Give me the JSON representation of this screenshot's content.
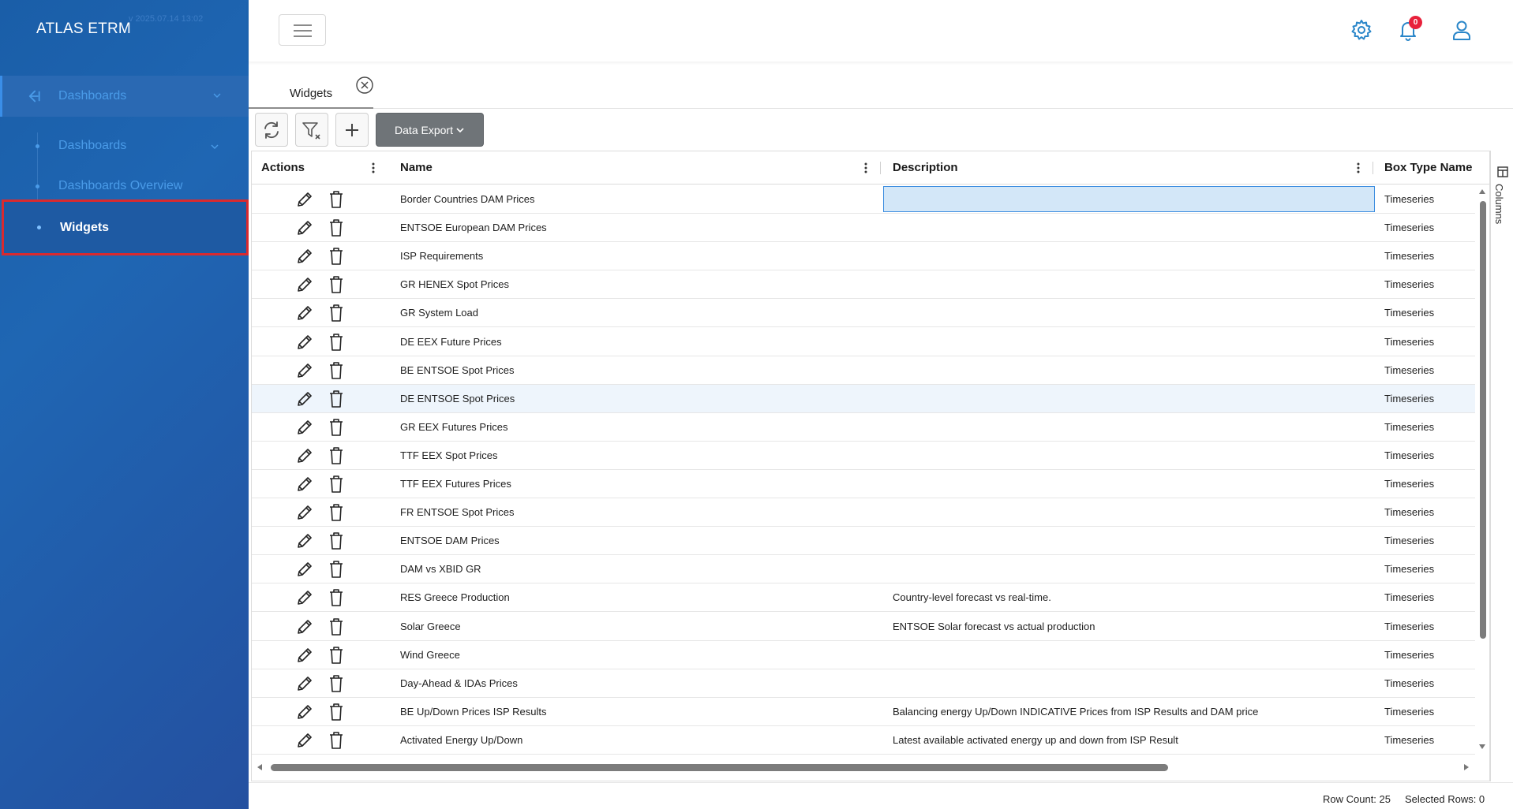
{
  "app": {
    "title": "ATLAS ETRM",
    "version": "v 2025.07.14 13:02"
  },
  "sidebar": {
    "section": {
      "label": "Dashboards"
    },
    "items": [
      {
        "label": "Dashboards"
      },
      {
        "label": "Dashboards Overview"
      },
      {
        "label": "Widgets"
      }
    ]
  },
  "header": {
    "notifications_count": "0"
  },
  "tabs": [
    {
      "label": "Widgets"
    }
  ],
  "toolbar": {
    "export_label": "Data Export"
  },
  "grid": {
    "columns": [
      "Actions",
      "Name",
      "Description",
      "Box Type Name"
    ],
    "rows": [
      {
        "name": "Border Countries DAM Prices",
        "description": "",
        "box_type": "Timeseries"
      },
      {
        "name": "ENTSOE European DAM Prices",
        "description": "",
        "box_type": "Timeseries"
      },
      {
        "name": "ISP Requirements",
        "description": "",
        "box_type": "Timeseries"
      },
      {
        "name": "GR HENEX Spot Prices",
        "description": "",
        "box_type": "Timeseries"
      },
      {
        "name": "GR System Load",
        "description": "",
        "box_type": "Timeseries"
      },
      {
        "name": "DE EEX Future Prices",
        "description": "",
        "box_type": "Timeseries"
      },
      {
        "name": "BE ENTSOE Spot Prices",
        "description": "",
        "box_type": "Timeseries"
      },
      {
        "name": "DE ENTSOE Spot Prices",
        "description": "",
        "box_type": "Timeseries"
      },
      {
        "name": "GR EEX Futures Prices",
        "description": "",
        "box_type": "Timeseries"
      },
      {
        "name": "TTF EEX Spot Prices",
        "description": "",
        "box_type": "Timeseries"
      },
      {
        "name": "TTF EEX Futures Prices",
        "description": "",
        "box_type": "Timeseries"
      },
      {
        "name": "FR ENTSOE Spot Prices",
        "description": "",
        "box_type": "Timeseries"
      },
      {
        "name": "ENTSOE DAM Prices",
        "description": "",
        "box_type": "Timeseries"
      },
      {
        "name": "DAM vs XBID GR",
        "description": "",
        "box_type": "Timeseries"
      },
      {
        "name": "RES Greece Production",
        "description": "Country-level forecast vs real-time.",
        "box_type": "Timeseries"
      },
      {
        "name": "Solar Greece",
        "description": "ENTSOE Solar forecast vs actual production",
        "box_type": "Timeseries"
      },
      {
        "name": "Wind Greece",
        "description": "",
        "box_type": "Timeseries"
      },
      {
        "name": "Day-Ahead & IDAs Prices",
        "description": "",
        "box_type": "Timeseries"
      },
      {
        "name": "BE Up/Down Prices ISP Results",
        "description": "Balancing energy Up/Down INDICATIVE Prices from ISP Results and DAM price",
        "box_type": "Timeseries"
      },
      {
        "name": "Activated Energy Up/Down",
        "description": "Latest available activated energy up and down from ISP Result",
        "box_type": "Timeseries"
      }
    ]
  },
  "side_panel": {
    "columns_label": "Columns"
  },
  "status": {
    "row_count": "Row Count: 25",
    "selected_rows": "Selected Rows: 0"
  },
  "colors": {
    "sidebar": "#1f66b3",
    "accent": "#4a9be8",
    "highlight_border": "#d92a2f",
    "focus_cell": "#d3e7f8"
  }
}
